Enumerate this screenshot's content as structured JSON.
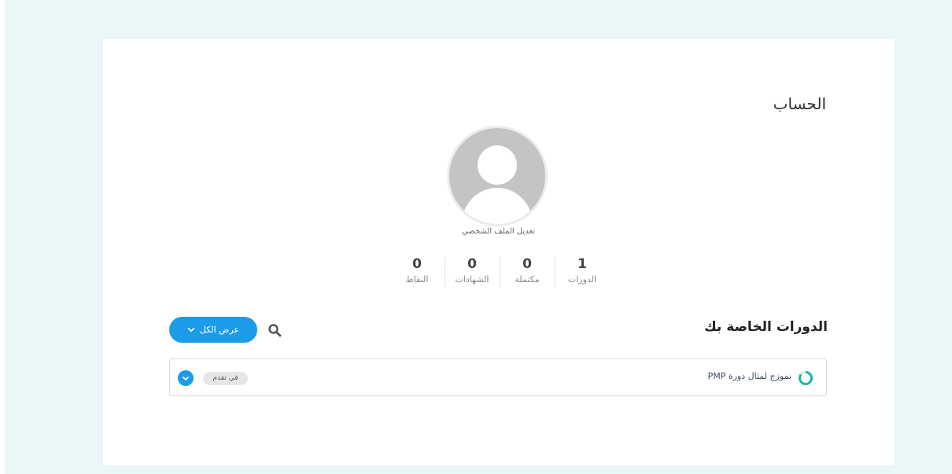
{
  "colors": {
    "page_background": "#eaf7f8",
    "accent": "#1c9be8",
    "progress_ring": "#1ab7a0"
  },
  "account": {
    "title": "الحساب",
    "edit_profile_label": "تعديل الملف الشخصي",
    "avatar_icon": "default-user-avatar"
  },
  "stats": [
    {
      "value": "1",
      "label": "الدورات"
    },
    {
      "value": "0",
      "label": "مكتملة"
    },
    {
      "value": "0",
      "label": "الشهادات"
    },
    {
      "value": "0",
      "label": "النقاط"
    }
  ],
  "courses": {
    "title": "الدورات الخاصة بك",
    "search_icon": "search-icon",
    "view_all_label": "عرض الكل",
    "view_all_icon": "chevron-down-icon",
    "items": [
      {
        "name": "نموزج لمثال دورة PMP",
        "status": "في تقدم",
        "progress": 0.85,
        "expand_icon": "chevron-down-icon"
      }
    ]
  }
}
